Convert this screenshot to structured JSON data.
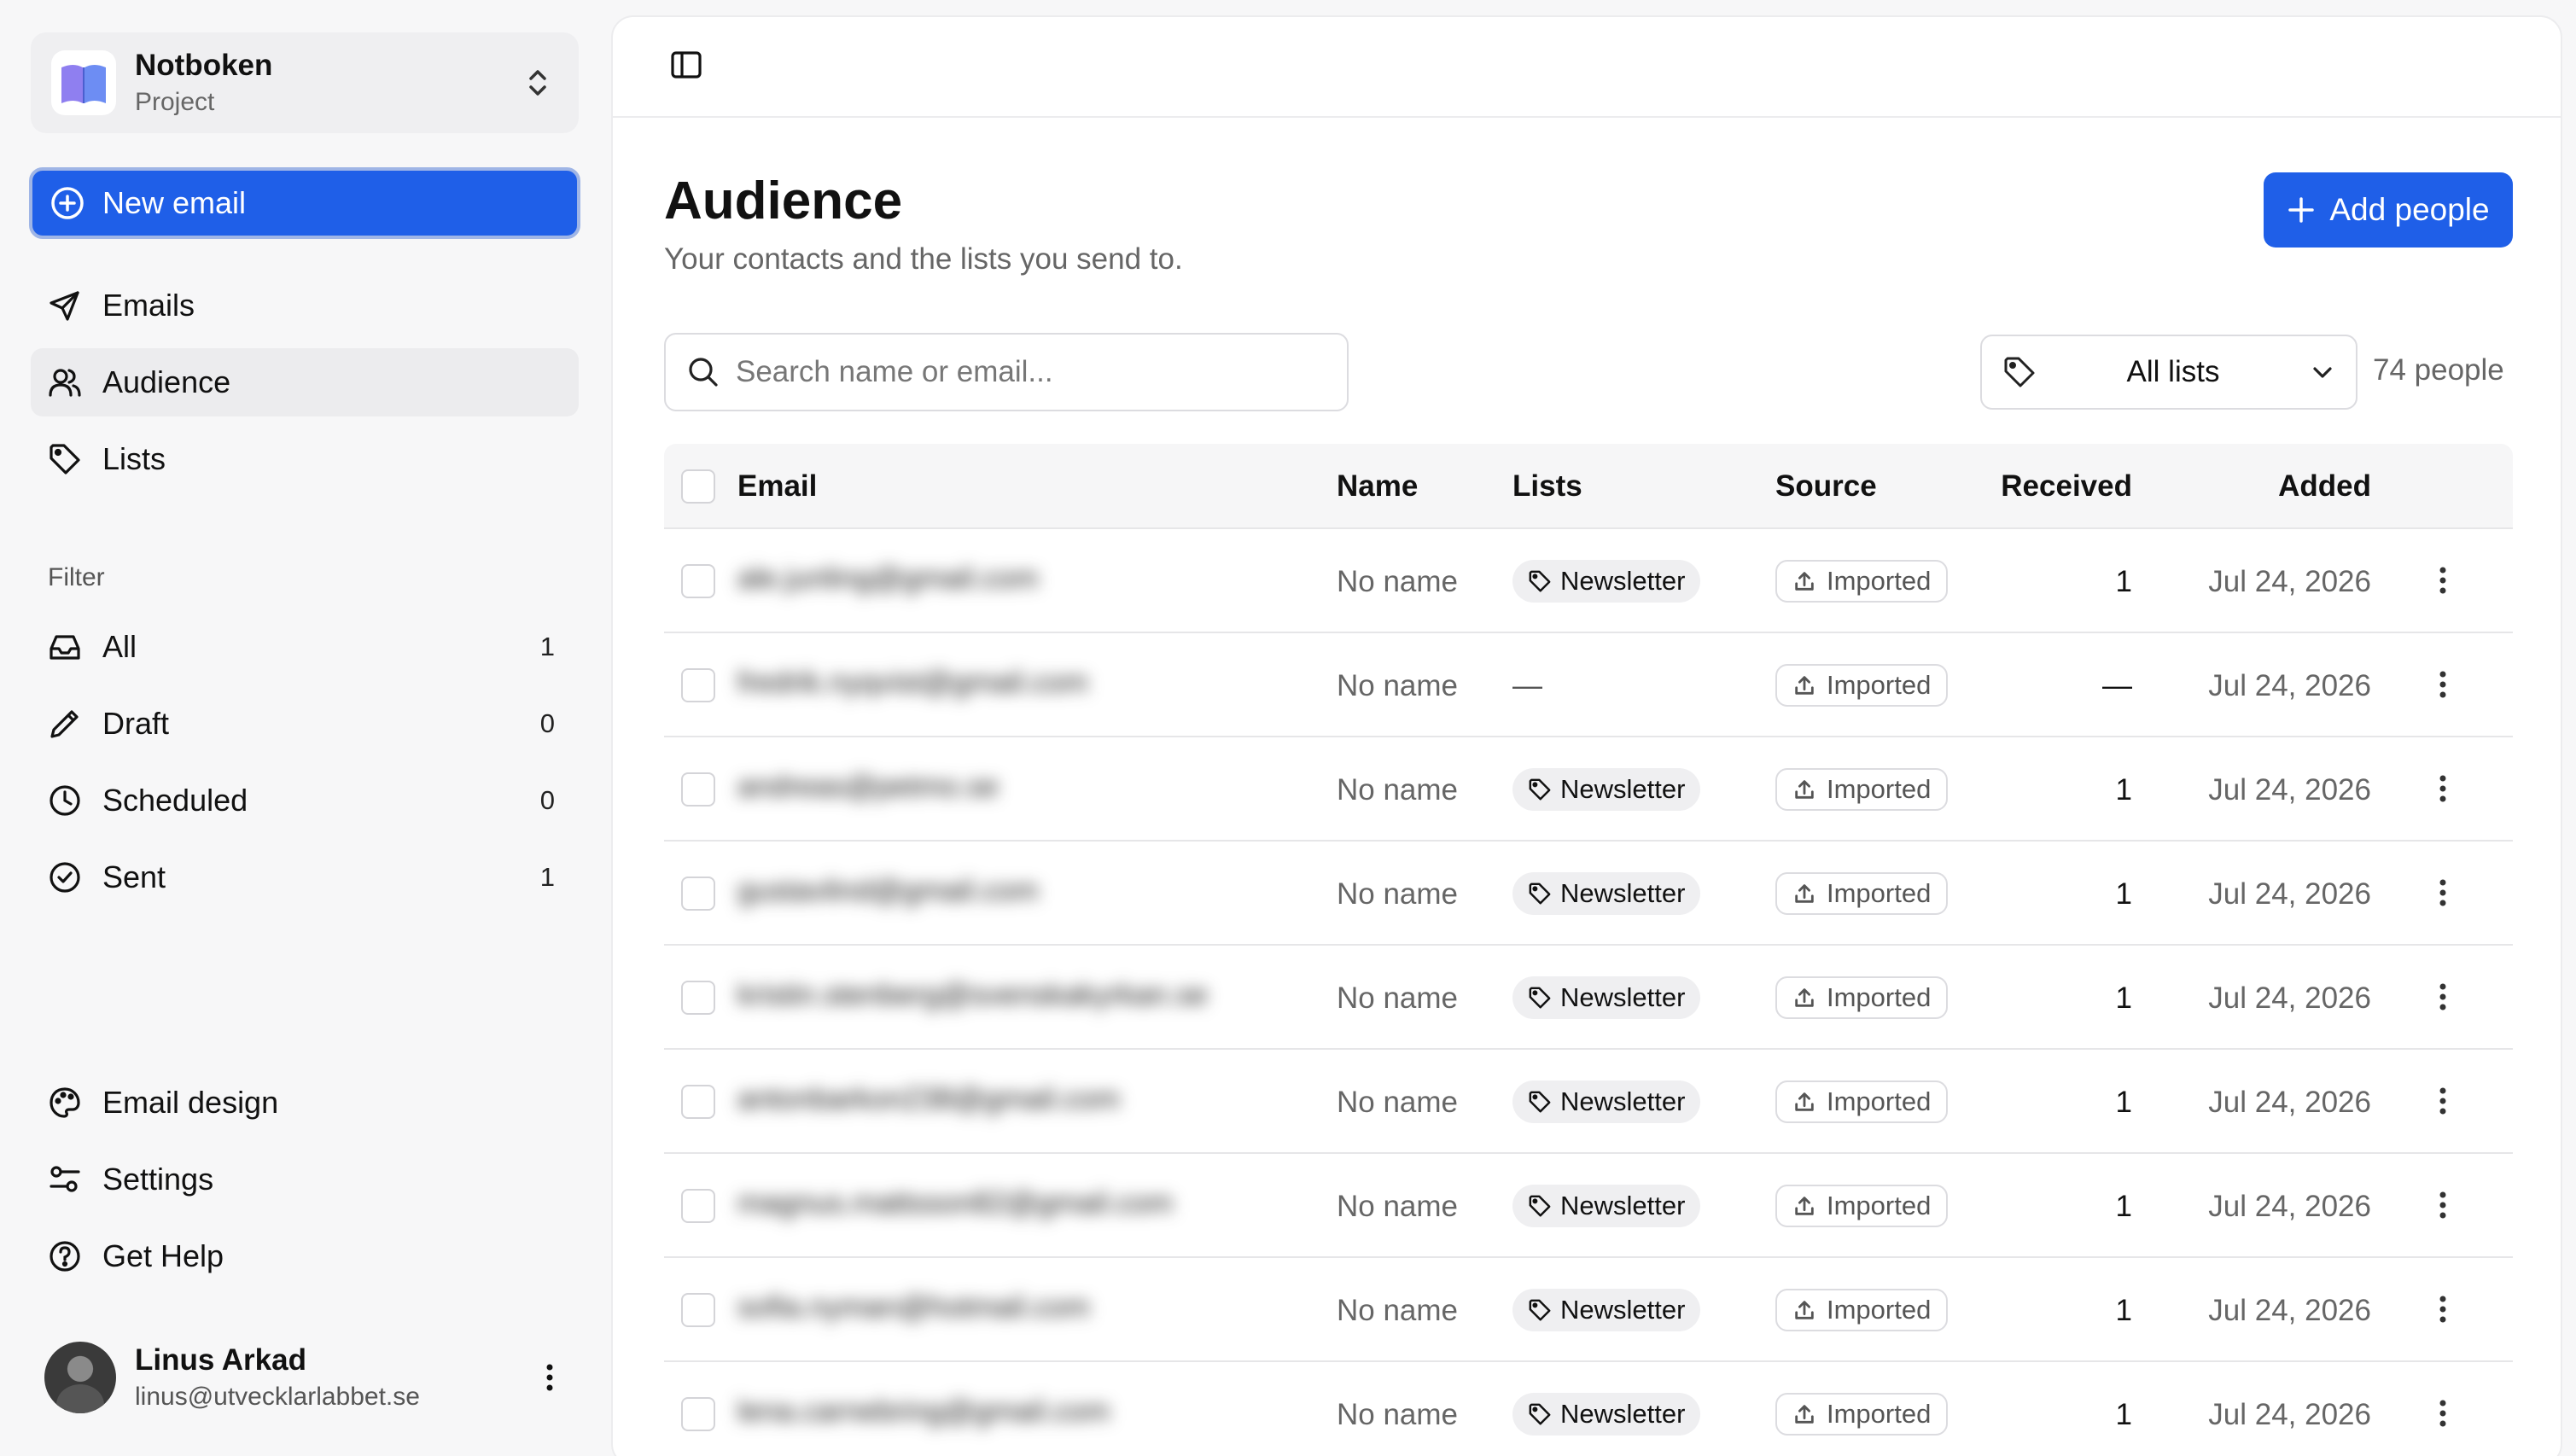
{
  "sidebar": {
    "project": {
      "name": "Notboken",
      "subtitle": "Project"
    },
    "new_email_label": "New email",
    "nav": [
      {
        "label": "Emails",
        "icon": "send-icon"
      },
      {
        "label": "Audience",
        "icon": "users-icon",
        "active": true
      },
      {
        "label": "Lists",
        "icon": "tag-icon"
      }
    ],
    "filter_heading": "Filter",
    "filters": [
      {
        "label": "All",
        "count": "1",
        "icon": "inbox-icon"
      },
      {
        "label": "Draft",
        "count": "0",
        "icon": "pencil-icon"
      },
      {
        "label": "Scheduled",
        "count": "0",
        "icon": "clock-icon"
      },
      {
        "label": "Sent",
        "count": "1",
        "icon": "check-circle-icon"
      }
    ],
    "bottom": [
      {
        "label": "Email design",
        "icon": "palette-icon"
      },
      {
        "label": "Settings",
        "icon": "sliders-icon"
      },
      {
        "label": "Get Help",
        "icon": "help-circle-icon"
      }
    ],
    "user": {
      "name": "Linus Arkad",
      "email": "linus@utvecklarlabbet.se"
    }
  },
  "main": {
    "title": "Audience",
    "subtitle": "Your contacts and the lists you send to.",
    "add_people_label": "Add people",
    "search_placeholder": "Search name or email...",
    "list_filter": "All lists",
    "people_count": "74 people",
    "columns": {
      "email": "Email",
      "name": "Name",
      "lists": "Lists",
      "source": "Source",
      "received": "Received",
      "added": "Added"
    },
    "rows": [
      {
        "email": "ale.junling@gmail.com",
        "name": "No name",
        "list": "Newsletter",
        "source": "Imported",
        "received": "1",
        "added": "Jul 24, 2026"
      },
      {
        "email": "fredrik.nyqvist@gmail.com",
        "name": "No name",
        "list": "—",
        "source": "Imported",
        "received": "—",
        "added": "Jul 24, 2026"
      },
      {
        "email": "andreas@petmo.se",
        "name": "No name",
        "list": "Newsletter",
        "source": "Imported",
        "received": "1",
        "added": "Jul 24, 2026"
      },
      {
        "email": "gustavlind@gmail.com",
        "name": "No name",
        "list": "Newsletter",
        "source": "Imported",
        "received": "1",
        "added": "Jul 24, 2026"
      },
      {
        "email": "kristin.stenberg@svenskakyrkan.se",
        "name": "No name",
        "list": "Newsletter",
        "source": "Imported",
        "received": "1",
        "added": "Jul 24, 2026"
      },
      {
        "email": "antonbarkon238@gmail.com",
        "name": "No name",
        "list": "Newsletter",
        "source": "Imported",
        "received": "1",
        "added": "Jul 24, 2026"
      },
      {
        "email": "magnus.mattsson82@gmail.com",
        "name": "No name",
        "list": "Newsletter",
        "source": "Imported",
        "received": "1",
        "added": "Jul 24, 2026"
      },
      {
        "email": "sofia.nyman@hotmail.com",
        "name": "No name",
        "list": "Newsletter",
        "source": "Imported",
        "received": "1",
        "added": "Jul 24, 2026"
      },
      {
        "email": "lena.carnebring@gmail.com",
        "name": "No name",
        "list": "Newsletter",
        "source": "Imported",
        "received": "1",
        "added": "Jul 24, 2026"
      }
    ]
  },
  "colors": {
    "accent": "#1f5fe8",
    "accent_ring": "#9fb5e6",
    "sidebar_bg": "#f7f7f8",
    "active_nav_bg": "#ececee"
  }
}
